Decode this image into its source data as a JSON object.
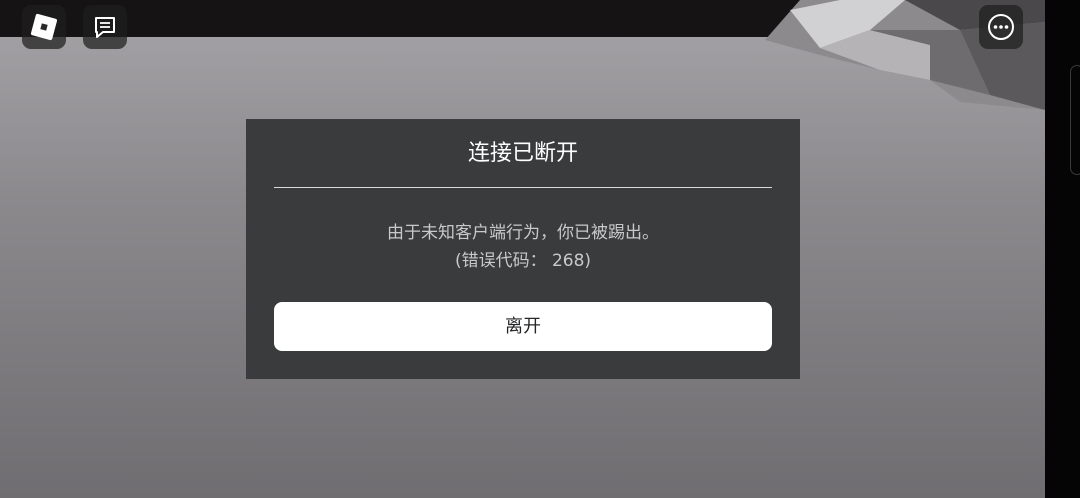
{
  "dialog": {
    "title": "连接已断开",
    "message_line1": "由于未知客户端行为，你已被踢出。",
    "message_line2": "(错误代码： 268)",
    "leave_button_label": "离开"
  },
  "toolbar": {
    "logo_icon": "roblox-logo-icon",
    "chat_icon": "chat-icon",
    "menu_icon": "more-options-icon"
  },
  "colors": {
    "dialog_background": "#393b3d",
    "button_background": "#ffffff",
    "top_bar": "#151314",
    "scene_background": "#9a989b"
  }
}
